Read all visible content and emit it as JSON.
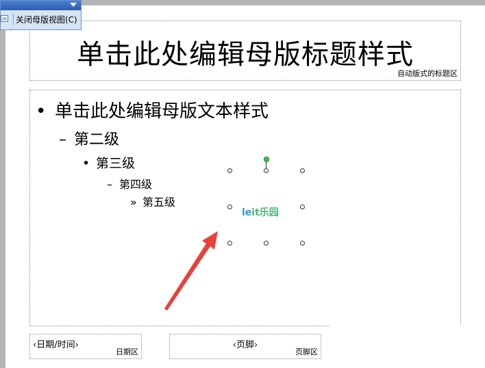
{
  "toolbar": {
    "close_master_label": "关闭母版视图(C)"
  },
  "title_placeholder": {
    "text": "单击此处编辑母版标题样式",
    "label": "自动版式的标题区"
  },
  "body_placeholder": {
    "level1": {
      "bullet": "•",
      "text": "单击此处编辑母版文本样式"
    },
    "level2": {
      "bullet": "–",
      "text": "第二级"
    },
    "level3": {
      "bullet": "•",
      "text": "第三级"
    },
    "level4": {
      "bullet": "–",
      "text": "第四级"
    },
    "level5": {
      "bullet": "»",
      "text": "第五级"
    }
  },
  "image": {
    "logo_part1": "le",
    "logo_part2": "it乐园"
  },
  "date_placeholder": {
    "text": "‹日期/时间›",
    "label": "日期区"
  },
  "footer_placeholder": {
    "text": "‹页脚›",
    "label": "页脚区"
  },
  "annotation": {
    "arrow_color": "#e8413a"
  }
}
